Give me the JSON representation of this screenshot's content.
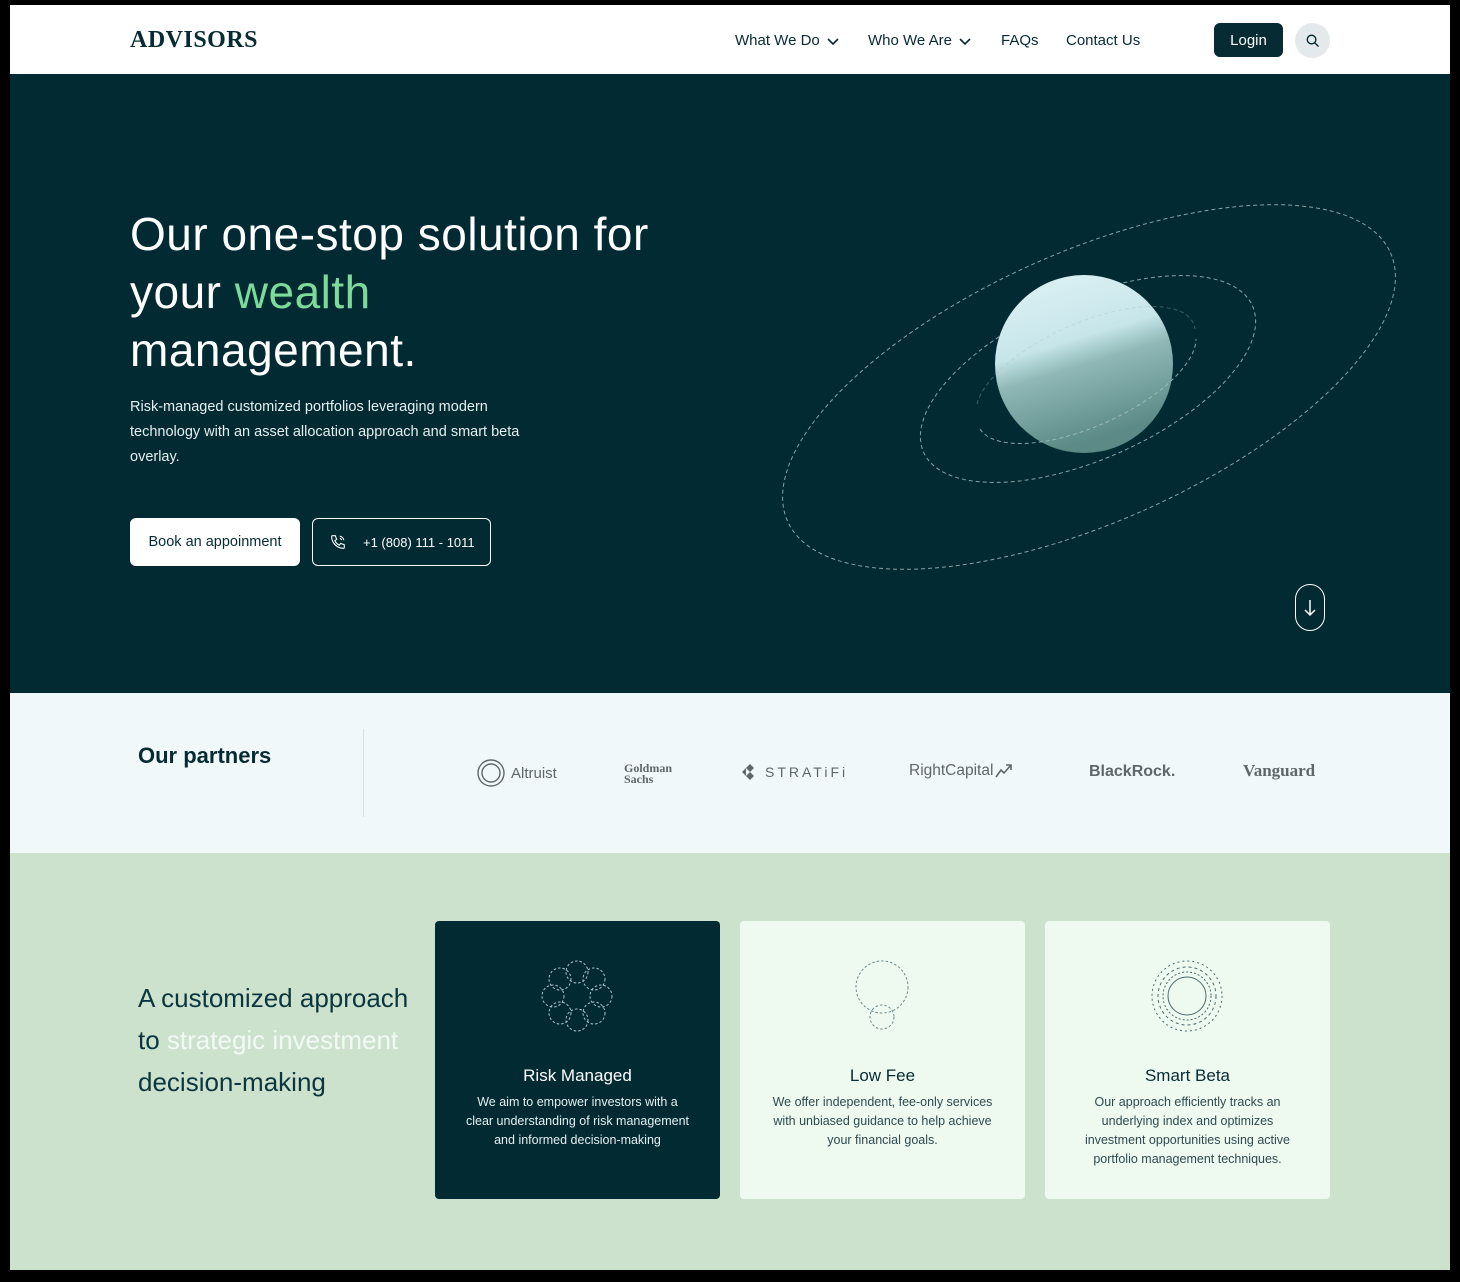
{
  "brand": {
    "logo": "ADVISORS"
  },
  "nav": {
    "items": [
      {
        "label": "What We Do",
        "has_dropdown": true
      },
      {
        "label": "Who We Are",
        "has_dropdown": true
      },
      {
        "label": "FAQs",
        "has_dropdown": false
      },
      {
        "label": "Contact Us",
        "has_dropdown": false
      }
    ],
    "login_label": "Login",
    "search_icon": "search-icon"
  },
  "hero": {
    "title_part1": "Our one-stop solution for your ",
    "title_accent": "wealth",
    "title_part2": "management.",
    "subtitle": "Risk-managed customized portfolios leveraging modern technology with an asset allocation approach and smart beta overlay.",
    "book_label": "Book an appoinment",
    "phone_label": "+1 (808) 111 - 1011",
    "accent_color": "#7ddb9a",
    "background_color": "#022a33"
  },
  "partners": {
    "title": "Our partners",
    "logos": [
      "Altruist",
      "Goldman Sachs",
      "STRATiFi",
      "RightCapital",
      "BlackRock.",
      "Vanguard"
    ]
  },
  "features": {
    "title_part1": "A customized approach to ",
    "title_light": "strategic investment",
    "title_part2": "decision-making",
    "cards": [
      {
        "title": "Risk Managed",
        "desc": "We aim to empower investors with a clear understanding of risk management and informed decision-making"
      },
      {
        "title": "Low Fee",
        "desc": "We offer independent, fee-only services with unbiased guidance to help achieve your financial goals."
      },
      {
        "title": "Smart Beta",
        "desc": "Our approach efficiently tracks an underlying index and optimizes investment opportunities using active portfolio management techniques."
      }
    ]
  }
}
